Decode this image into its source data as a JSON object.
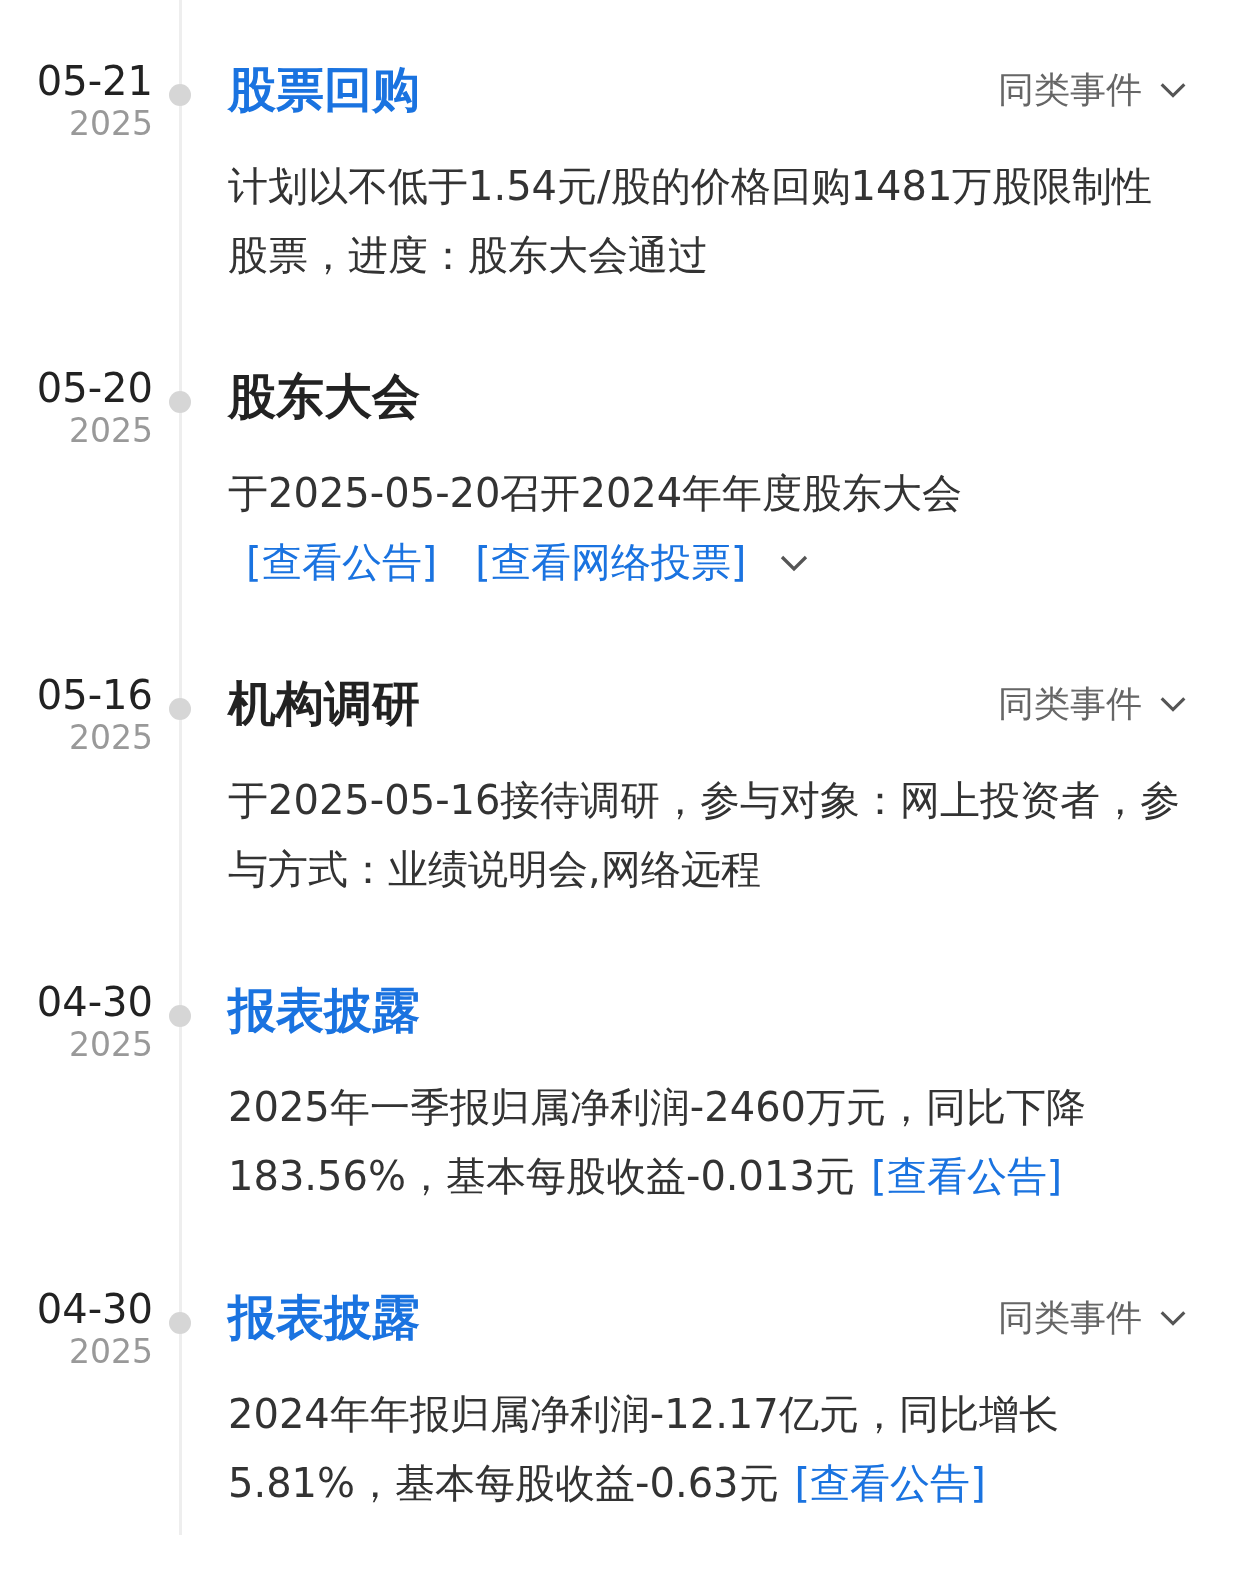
{
  "events": [
    {
      "date": "05-21",
      "year": "2025",
      "title": "股票回购",
      "linked": true,
      "similar": "同类事件",
      "description": "计划以不低于1.54元/股的价格回购1481万股限制性股票，进度：股东大会通过"
    },
    {
      "date": "05-20",
      "year": "2025",
      "title": "股东大会",
      "linked": false,
      "description": "于2025-05-20召开2024年年度股东大会",
      "links": [
        "[查看公告]",
        "[查看网络投票]"
      ],
      "links_on_new_line": true,
      "more": true
    },
    {
      "date": "05-16",
      "year": "2025",
      "title": "机构调研",
      "linked": false,
      "similar": "同类事件",
      "description": "于2025-05-16接待调研，参与对象：网上投资者，参与方式：业绩说明会,网络远程"
    },
    {
      "date": "04-30",
      "year": "2025",
      "title": "报表披露",
      "linked": true,
      "description": "2025年一季报归属净利润-2460万元，同比下降183.56%，基本每股收益-0.013元",
      "links": [
        "[查看公告]"
      ]
    },
    {
      "date": "04-30",
      "year": "2025",
      "title": "报表披露",
      "linked": true,
      "similar": "同类事件",
      "description": "2024年年报归属净利润-12.17亿元，同比增长5.81%，基本每股收益-0.63元",
      "links": [
        "[查看公告]"
      ]
    }
  ]
}
